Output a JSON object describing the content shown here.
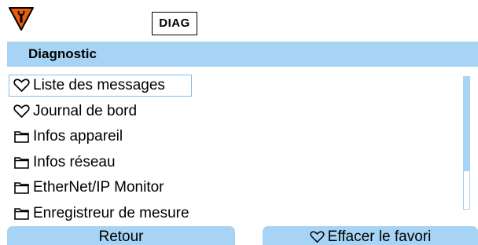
{
  "status": {
    "icon": "maintenance-required-wrench-icon",
    "color": "#e85c0d"
  },
  "mode_badge": "DIAG",
  "header": {
    "title": "Diagnostic"
  },
  "menu": {
    "items": [
      {
        "label": "Liste des messages",
        "icon": "heart-icon",
        "selected": true
      },
      {
        "label": "Journal de bord",
        "icon": "heart-icon",
        "selected": false
      },
      {
        "label": "Infos appareil",
        "icon": "folder-icon",
        "selected": false
      },
      {
        "label": "Infos réseau",
        "icon": "folder-icon",
        "selected": false
      },
      {
        "label": "EtherNet/IP Monitor",
        "icon": "folder-icon",
        "selected": false
      },
      {
        "label": "Enregistreur de mesure",
        "icon": "folder-icon",
        "selected": false
      }
    ]
  },
  "softkeys": {
    "left": {
      "label": "Retour"
    },
    "right": {
      "label": "Effacer le favori",
      "icon": "heart-icon"
    }
  },
  "colors": {
    "accent": "#a7d4f4",
    "selection_border": "#7fc0ea",
    "warning": "#e85c0d"
  }
}
